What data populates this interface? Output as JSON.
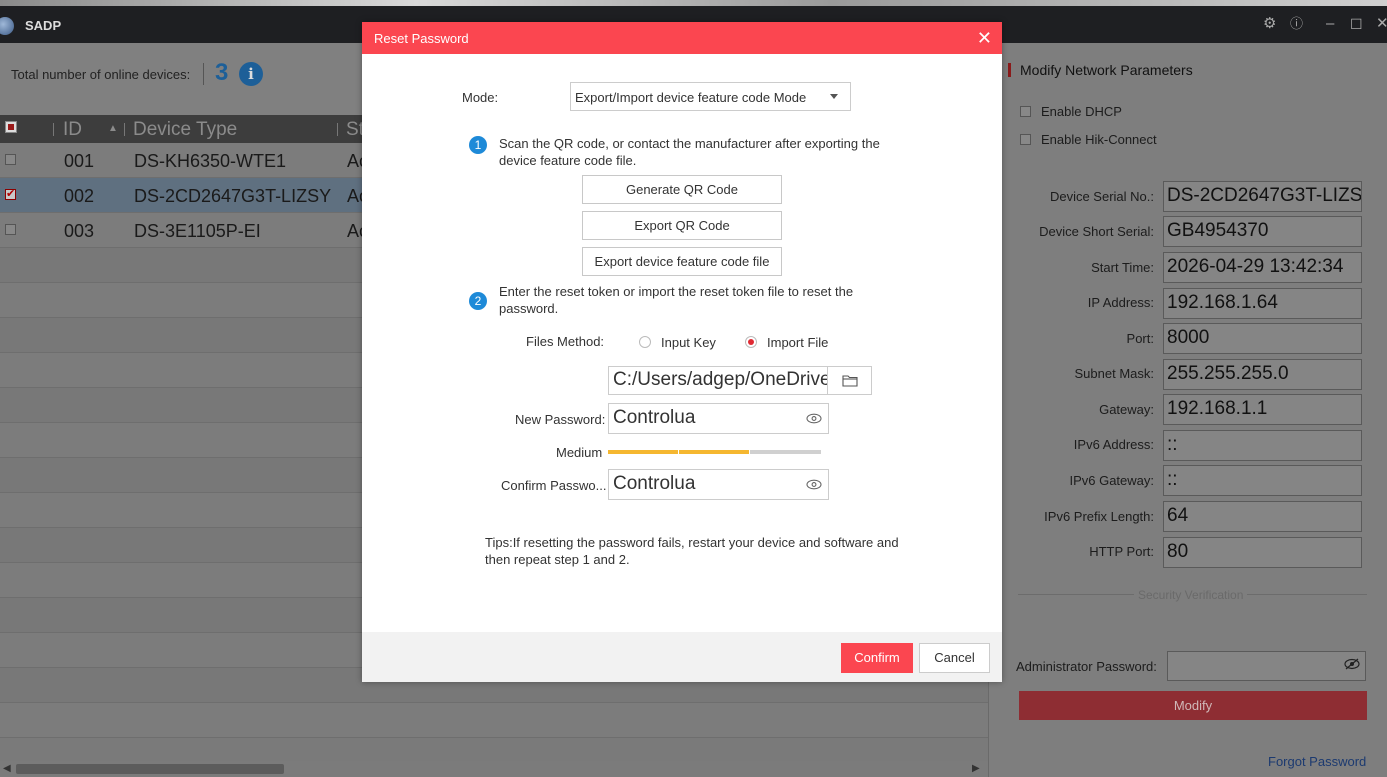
{
  "app": {
    "title": "SADP"
  },
  "summary": {
    "label": "Total number of online devices:",
    "count": "3"
  },
  "table": {
    "columns": [
      "ID",
      "Device Type",
      "St"
    ],
    "rows": [
      {
        "id": "001",
        "device_type": "DS-KH6350-WTE1",
        "status": "Ac",
        "checked": false,
        "selected": false
      },
      {
        "id": "002",
        "device_type": "DS-2CD2647G3T-LIZSY",
        "status": "Ac",
        "checked": true,
        "selected": true
      },
      {
        "id": "003",
        "device_type": "DS-3E1105P-EI",
        "status": "Ac",
        "checked": false,
        "selected": false
      }
    ]
  },
  "right_panel": {
    "title": "Modify Network Parameters",
    "enable_dhcp": "Enable DHCP",
    "enable_hik_connect": "Enable Hik-Connect",
    "fields": [
      {
        "label": "Device Serial No.:",
        "value": "DS-2CD2647G3T-LIZSY"
      },
      {
        "label": "Device Short Serial:",
        "value": "GB4954370"
      },
      {
        "label": "Start Time:",
        "value": "2026-04-29 13:42:34"
      },
      {
        "label": "IP Address:",
        "value": "192.168.1.64"
      },
      {
        "label": "Port:",
        "value": "8000"
      },
      {
        "label": "Subnet Mask:",
        "value": "255.255.255.0"
      },
      {
        "label": "Gateway:",
        "value": "192.168.1.1"
      },
      {
        "label": "IPv6 Address:",
        "value": "::"
      },
      {
        "label": "IPv6 Gateway:",
        "value": "::"
      },
      {
        "label": "IPv6 Prefix Length:",
        "value": "64"
      },
      {
        "label": "HTTP Port:",
        "value": "80"
      }
    ],
    "security_verification": "Security Verification",
    "admin_password_label": "Administrator Password:",
    "modify_label": "Modify",
    "forgot_password": "Forgot Password"
  },
  "modal": {
    "title": "Reset Password",
    "mode_label": "Mode:",
    "mode_value": "Export/Import device feature code Mode",
    "step1_number": "1",
    "step1_text": "Scan the QR code, or contact the manufacturer after exporting the device feature code file.",
    "generate_qr": "Generate QR Code",
    "export_qr": "Export QR Code",
    "export_feature": "Export device feature code file",
    "step2_number": "2",
    "step2_text": "Enter the reset token or import the reset token file to reset the password.",
    "files_method_label": "Files Method:",
    "option_input_key": "Input Key",
    "option_import_file": "Import File",
    "selected_option": "Import File",
    "file_path": "C:/Users/adgep/OneDrive",
    "new_password_label": "New Password:",
    "new_password_value": "Controlua",
    "strength_label": "Medium",
    "strength_level": "2/3",
    "confirm_password_label": "Confirm Passwo...",
    "confirm_password_value": "Controlua",
    "tips": "Tips:If resetting the password fails, restart your device and software and then repeat step 1 and 2.",
    "confirm_label": "Confirm",
    "cancel_label": "Cancel"
  },
  "colors": {
    "accent_red": "#fb4650",
    "step_blue": "#1e8ad8",
    "strength_yellow": "#f5b730",
    "strength_empty": "#d0d0d0"
  }
}
